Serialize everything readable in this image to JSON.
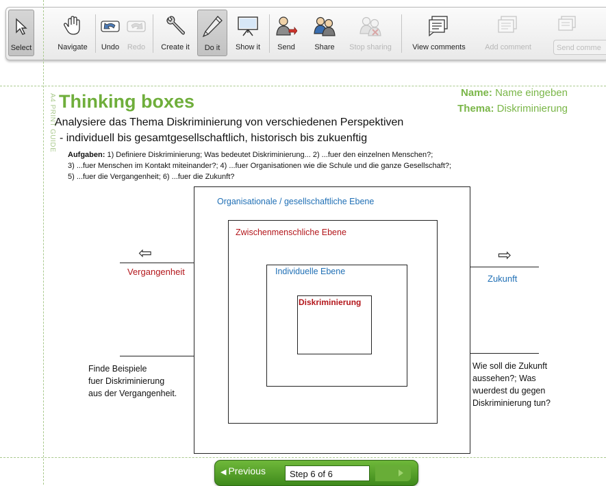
{
  "toolbar": {
    "select": "Select",
    "navigate": "Navigate",
    "undo": "Undo",
    "redo": "Redo",
    "create_it": "Create it",
    "do_it": "Do it",
    "show_it": "Show it",
    "send": "Send",
    "share": "Share",
    "stop_sharing": "Stop sharing",
    "view_comments": "View comments",
    "add_comment": "Add comment",
    "send_comment": "Send comme"
  },
  "guide_label": "A4 PRINT GUIDE",
  "doc": {
    "title": "Thinking boxes",
    "name_label": "Name:",
    "name_value": "Name eingeben",
    "thema_label": "Thema:",
    "thema_value": "Diskriminierung",
    "subtitle": "Analysiere das Thema Diskriminierung von verschiedenen Perspektiven",
    "subtitle2": "- individuell bis gesamtgesellschaftlich, historisch bis zukuenftig",
    "tasks_label": "Aufgaben:",
    "tasks_line1": "1) Definiere Diskriminierung; Was bedeutet Diskriminierung... 2) ...fuer den einzelnen Menschen?;",
    "tasks_line2": "3) ...fuer Menschen im Kontakt miteinander?; 4) ...fuer Organisationen wie die Schule und die ganze Gesellschaft?;",
    "tasks_line3": "5) ...fuer die Vergangenheit; 6) ...fuer die Zukunft?",
    "box_outer": "Organisationale / gesellschaftliche Ebene",
    "box_middle": "Zwischenmenschliche Ebene",
    "box_inner": "Individuelle Ebene",
    "box_center": "Diskriminierung",
    "left_label": "Vergangenheit",
    "right_label": "Zukunft",
    "left_note_1": "Finde Beispiele",
    "left_note_2": "fuer Diskriminierung",
    "left_note_3": "aus der Vergangenheit.",
    "right_note_1": "Wie soll die Zukunft",
    "right_note_2": "aussehen?; Was",
    "right_note_3": "wuerdest du gegen",
    "right_note_4": "Diskriminierung tun?"
  },
  "stepnav": {
    "previous": "Previous",
    "step": "Step 6 of 6"
  },
  "colors": {
    "title_green": "#6fae3b",
    "outer_blue": "#1f6fb5",
    "middle_red": "#b3161b",
    "nav_green": "#4f9a27"
  }
}
